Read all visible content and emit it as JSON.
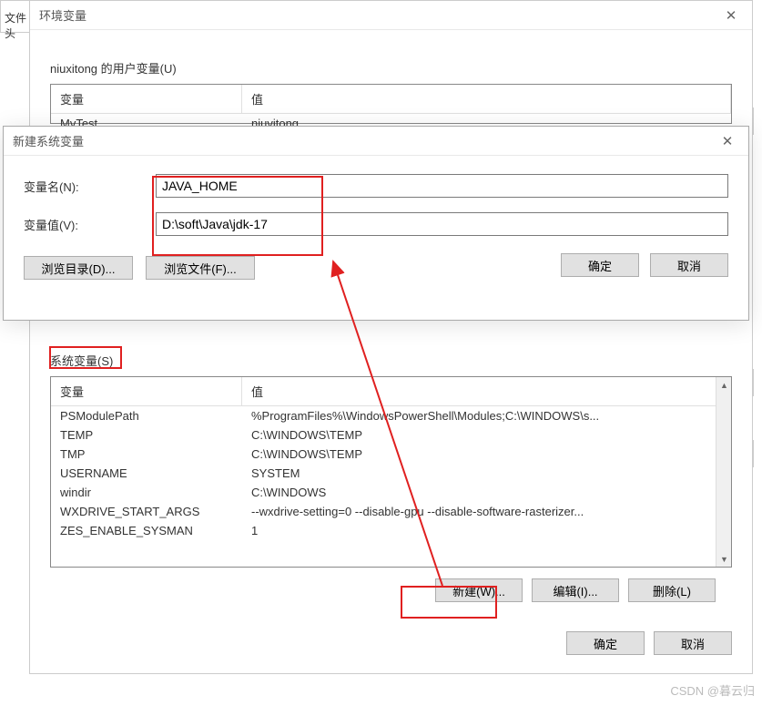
{
  "file_tab_text": "文件头",
  "env_dialog": {
    "title": "环境变量",
    "user_vars_label": "niuxitong 的用户变量(U)",
    "cols": {
      "var": "变量",
      "val": "值"
    },
    "user_row1": {
      "var": "MvTest",
      "val": "niuvitong"
    },
    "sys_vars_label": "系统变量(S)",
    "sys_rows": [
      {
        "var": "PSModulePath",
        "val": "%ProgramFiles%\\WindowsPowerShell\\Modules;C:\\WINDOWS\\s..."
      },
      {
        "var": "TEMP",
        "val": "C:\\WINDOWS\\TEMP"
      },
      {
        "var": "TMP",
        "val": "C:\\WINDOWS\\TEMP"
      },
      {
        "var": "USERNAME",
        "val": "SYSTEM"
      },
      {
        "var": "windir",
        "val": "C:\\WINDOWS"
      },
      {
        "var": "WXDRIVE_START_ARGS",
        "val": "--wxdrive-setting=0 --disable-gpu --disable-software-rasterizer..."
      },
      {
        "var": "ZES_ENABLE_SYSMAN",
        "val": "1"
      }
    ],
    "btn_new": "新建(W)...",
    "btn_edit": "编辑(I)...",
    "btn_delete": "删除(L)",
    "btn_ok": "确定",
    "btn_cancel": "取消"
  },
  "new_dialog": {
    "title": "新建系统变量",
    "name_label": "变量名(N):",
    "name_value": "JAVA_HOME",
    "value_label": "变量值(V):",
    "value_value": "D:\\soft\\Java\\jdk-17",
    "btn_browse_dir": "浏览目录(D)...",
    "btn_browse_file": "浏览文件(F)...",
    "btn_ok": "确定",
    "btn_cancel": "取消"
  },
  "watermark": "CSDN @暮云归"
}
